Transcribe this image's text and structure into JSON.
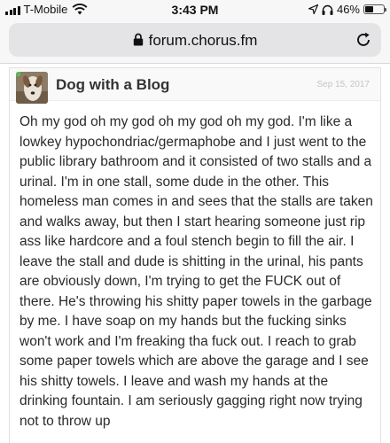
{
  "status_bar": {
    "carrier": "T-Mobile",
    "time": "3:43 PM",
    "battery_percent": "46%",
    "battery_level": 0.46
  },
  "browser": {
    "url": "forum.chorus.fm"
  },
  "post": {
    "author": "Dog with a Blog",
    "date": "Sep 15, 2017",
    "body": "Oh my god oh my god oh my god oh my god. I'm like a lowkey hypochondriac/germaphobe and I just went to the public library bathroom and it consisted of two stalls and a urinal. I'm in one stall, some dude in the other. This homeless man comes in and sees that the stalls are taken and walks away, but then I start hearing someone just rip ass like hardcore and a foul stench begin to fill the air. I leave the stall and dude is shitting in the urinal, his pants are obviously down, I'm trying to get the FUCK out of there. He's throwing his shitty paper towels in the garbage by me. I have soap on my hands but the fucking sinks won't work and I'm freaking tha fuck out. I reach to grab some paper towels which are above the garage and I see his shitty towels. I leave and wash my hands at the drinking fountain. I am seriously gagging right now trying not to throw up"
  },
  "icons": {
    "signal": "signal-bars-icon",
    "wifi": "wifi-icon",
    "location": "location-arrow-icon",
    "headphones": "headphones-icon",
    "battery": "battery-icon",
    "lock": "lock-icon",
    "reload": "reload-icon"
  }
}
